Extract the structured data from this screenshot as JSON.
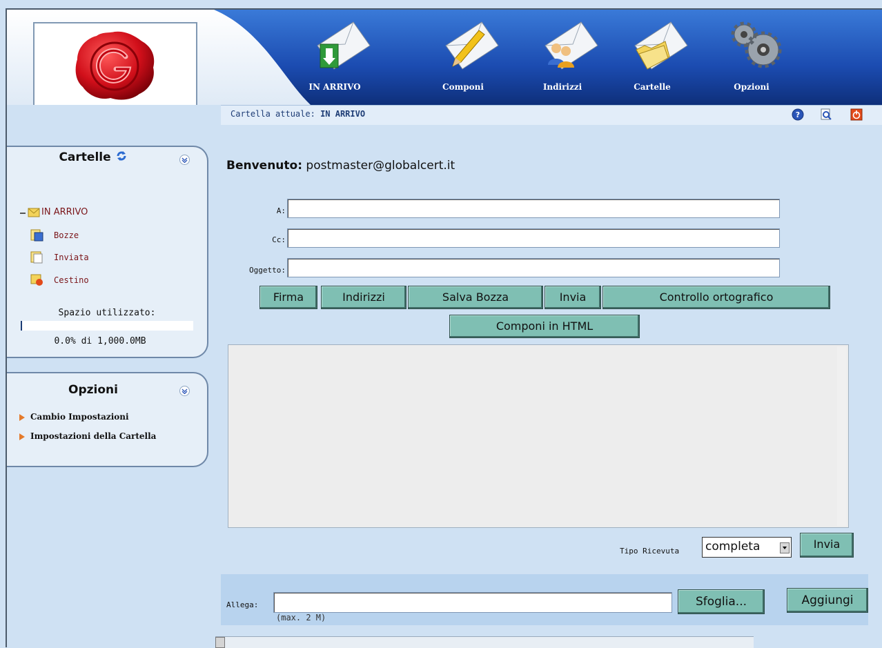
{
  "nav": {
    "items": [
      {
        "label": "IN ARRIVO",
        "icon": "inbox-envelope-icon"
      },
      {
        "label": "Componi",
        "icon": "compose-envelope-icon"
      },
      {
        "label": "Indirizzi",
        "icon": "contacts-envelope-icon"
      },
      {
        "label": "Cartelle",
        "icon": "folders-envelope-icon"
      },
      {
        "label": "Opzioni",
        "icon": "gears-icon"
      }
    ]
  },
  "status": {
    "label": "Cartella attuale:",
    "value": "IN ARRIVO",
    "icons": [
      "help-icon",
      "search-icon",
      "logout-icon"
    ]
  },
  "folders_panel": {
    "title": "Cartelle",
    "items": [
      {
        "label": "IN ARRIVO",
        "icon": "inbox-folder-icon"
      },
      {
        "label": "Bozze",
        "icon": "drafts-folder-icon"
      },
      {
        "label": "Inviata",
        "icon": "sent-folder-icon"
      },
      {
        "label": "Cestino",
        "icon": "trash-folder-icon"
      }
    ],
    "usage_label": "Spazio utilizzato:",
    "usage_percent": 0.0,
    "usage_text": "0.0% di 1,000.0MB"
  },
  "options_panel": {
    "title": "Opzioni",
    "links": [
      "Cambio Impostazioni",
      "Impostazioni della Cartella"
    ]
  },
  "compose": {
    "welcome_label": "Benvenuto:",
    "welcome_user": "postmaster@globalcert.it",
    "to_label": "A:",
    "cc_label": "Cc:",
    "subject_label": "Oggetto:",
    "to_value": "",
    "cc_value": "",
    "subject_value": "",
    "buttons": {
      "firma": "Firma",
      "indirizzi": "Indirizzi",
      "salva_bozza": "Salva Bozza",
      "invia": "Invia",
      "controllo": "Controllo ortografico",
      "html": "Componi in HTML"
    },
    "body_value": "",
    "receipt_label": "Tipo Ricevuta",
    "receipt_value": "completa",
    "send_label": "Invia"
  },
  "attachment": {
    "label": "Allega:",
    "browse_label": "Sfoglia...",
    "add_label": "Aggiungi",
    "note": "(max. 2 M)"
  },
  "colors": {
    "header_blue": "#1d4aa8",
    "button_teal": "#7fbfb3",
    "background": "#cfe1f3"
  }
}
